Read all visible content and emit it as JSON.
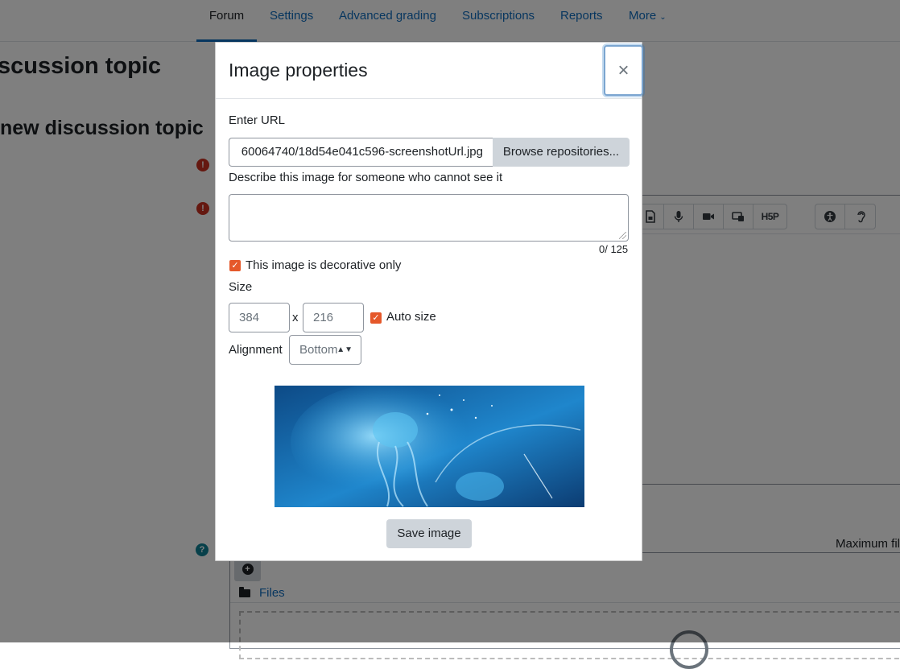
{
  "nav": {
    "items": [
      {
        "label": "Forum",
        "active": true
      },
      {
        "label": "Settings"
      },
      {
        "label": "Advanced grading"
      },
      {
        "label": "Subscriptions"
      },
      {
        "label": "Reports"
      },
      {
        "label": "More"
      }
    ]
  },
  "page": {
    "heading1": "scussion topic",
    "heading2": "new discussion topic",
    "max_file_label": "Maximum fil",
    "files_label": "Files",
    "accent_color": "#0f6cbf"
  },
  "modal": {
    "title": "Image properties",
    "close_symbol": "×",
    "url_label": "Enter URL",
    "url_value": "60064740/18d54e041c596-screenshotUrl.jpg",
    "browse_label": "Browse repositories...",
    "alt_label": "Describe this image for someone who cannot see it",
    "alt_value": "",
    "char_counter": "0/ 125",
    "decorative_label": "This image is decorative only",
    "decorative_checked": true,
    "size_label": "Size",
    "width_value": "384",
    "size_separator": "x",
    "height_value": "216",
    "auto_size_label": "Auto size",
    "auto_size_checked": true,
    "alignment_label": "Alignment",
    "alignment_value": "Bottom",
    "save_label": "Save image",
    "checkbox_color": "#e5582a"
  }
}
